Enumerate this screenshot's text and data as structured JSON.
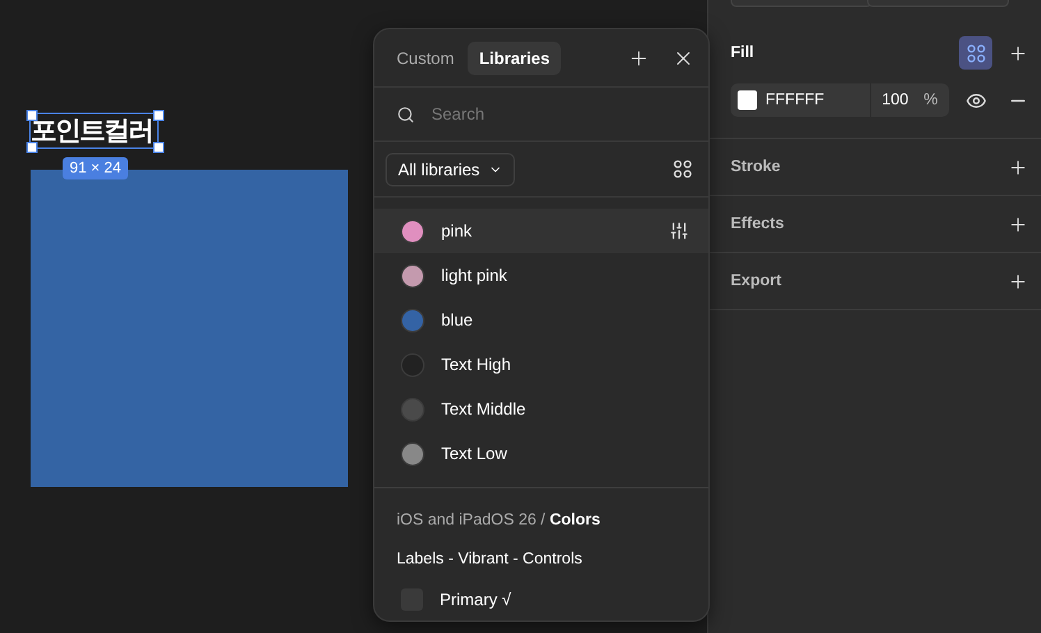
{
  "canvas": {
    "text_layer": "포인트컬러",
    "size_badge": "91 × 24",
    "selected": true
  },
  "color_picker": {
    "tabs": [
      {
        "label": "Custom",
        "selected": false
      },
      {
        "label": "Libraries",
        "selected": true
      }
    ],
    "search": {
      "placeholder": "Search"
    },
    "library_filter": "All libraries",
    "colors": [
      {
        "name": "pink",
        "color": "#e08fbf",
        "selected": true
      },
      {
        "name": "light pink",
        "color": "#c49aae",
        "selected": false
      },
      {
        "name": "blue",
        "color": "#3463a5",
        "selected": false
      },
      {
        "name": "Text High",
        "color": "#222222",
        "selected": false
      },
      {
        "name": "Text Middle",
        "color": "#4a4a4a",
        "selected": false
      },
      {
        "name": "Text Low",
        "color": "#888888",
        "selected": false
      }
    ],
    "library_path": "iOS and iPadOS 26 / **Colors**",
    "group": "Labels - Vibrant - Controls",
    "group_items": [
      {
        "name": "Primary √",
        "color": "#3a3a3a"
      }
    ]
  },
  "properties": {
    "fill": {
      "title": "Fill",
      "hex": "FFFFFF",
      "opacity": "100",
      "unit": "%",
      "visible": true
    },
    "sections": [
      "Stroke",
      "Effects",
      "Export"
    ]
  }
}
